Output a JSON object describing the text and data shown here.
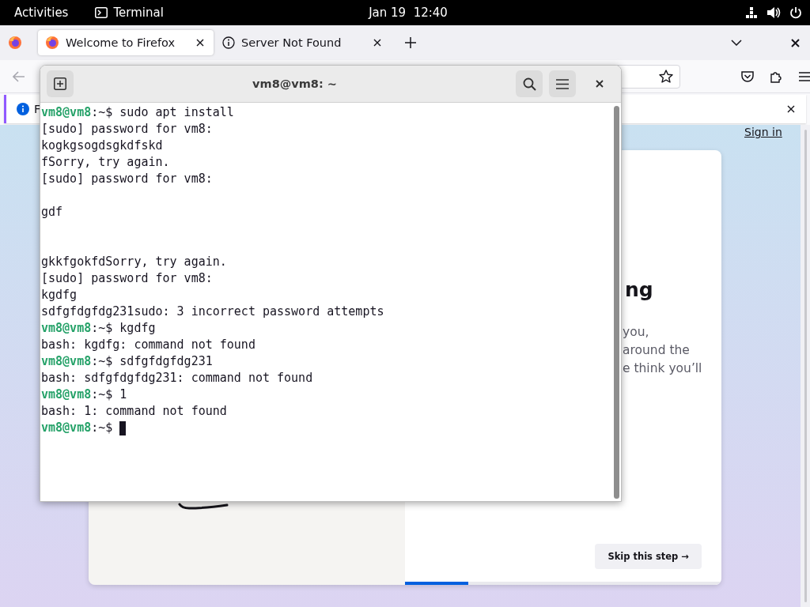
{
  "top_bar": {
    "activities": "Activities",
    "app": "Terminal",
    "clock": "Jan 19  12:40"
  },
  "browser": {
    "tabs": [
      {
        "title": "Welcome to Firefox",
        "selected": true,
        "kind": "firefox"
      },
      {
        "title": "Server Not Found",
        "selected": false,
        "kind": "info"
      }
    ],
    "notification": {
      "text": "F"
    },
    "page": {
      "sign_in": "Sign in",
      "heading": "ng",
      "body_lines": [
        "you,",
        "around the",
        "e think you’ll"
      ],
      "skip_button": "Skip this step →",
      "progress": {
        "level": 0.2
      }
    }
  },
  "terminal": {
    "title": "vm8@vm8: ~",
    "lines": [
      {
        "kind": "prompt",
        "host": "vm8@vm8",
        "suffix": ":~$ ",
        "text": "sudo apt install"
      },
      {
        "kind": "output",
        "text": "[sudo] password for vm8:"
      },
      {
        "kind": "output",
        "text": "kogkgsogdsgkdfskd"
      },
      {
        "kind": "output",
        "text": "fSorry, try again."
      },
      {
        "kind": "output",
        "text": "[sudo] password for vm8:"
      },
      {
        "kind": "blank"
      },
      {
        "kind": "output",
        "text": "gdf"
      },
      {
        "kind": "blank"
      },
      {
        "kind": "blank"
      },
      {
        "kind": "output",
        "text": "gkkfgokfdSorry, try again."
      },
      {
        "kind": "output",
        "text": "[sudo] password for vm8:"
      },
      {
        "kind": "output",
        "text": "kgdfg"
      },
      {
        "kind": "output",
        "text": "sdfgfdgfdg231sudo: 3 incorrect password attempts"
      },
      {
        "kind": "prompt",
        "host": "vm8@vm8",
        "suffix": ":~$ ",
        "text": "kgdfg"
      },
      {
        "kind": "output",
        "text": "bash: kgdfg: command not found"
      },
      {
        "kind": "prompt",
        "host": "vm8@vm8",
        "suffix": ":~$ ",
        "text": "sdfgfdgfdg231"
      },
      {
        "kind": "output",
        "text": "bash: sdfgfdgfdg231: command not found"
      },
      {
        "kind": "prompt",
        "host": "vm8@vm8",
        "suffix": ":~$ ",
        "text": "1"
      },
      {
        "kind": "output",
        "text": "bash: 1: command not found"
      },
      {
        "kind": "prompt",
        "host": "vm8@vm8",
        "suffix": ":~$ ",
        "cursor": true
      }
    ]
  }
}
